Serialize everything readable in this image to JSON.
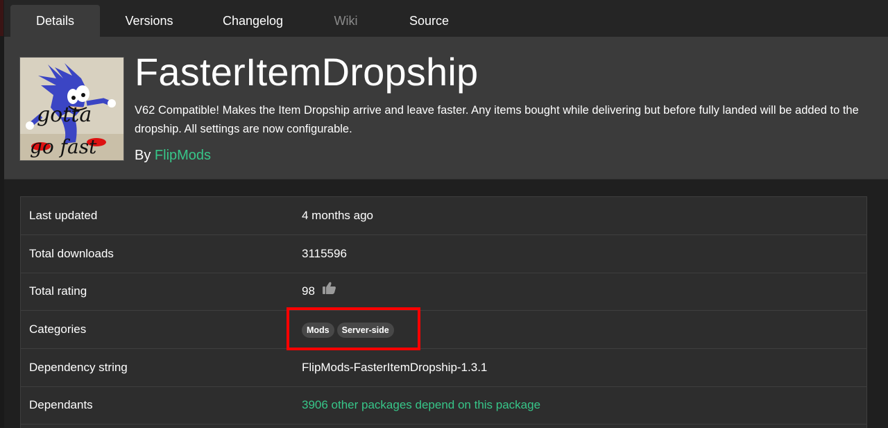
{
  "tabs": [
    {
      "label": "Details"
    },
    {
      "label": "Versions"
    },
    {
      "label": "Changelog"
    },
    {
      "label": "Wiki"
    },
    {
      "label": "Source"
    }
  ],
  "package": {
    "title": "FasterItemDropship",
    "description": "V62 Compatible! Makes the Item Dropship arrive and leave faster. Any items bought while delivering but before fully landed will be added to the dropship. All settings are now configurable.",
    "by_label": "By",
    "author": "FlipMods",
    "thumbnail_text_line1": "gotta",
    "thumbnail_text_line2": "go fast"
  },
  "details": {
    "last_updated": {
      "label": "Last updated",
      "value": "4 months ago"
    },
    "total_downloads": {
      "label": "Total downloads",
      "value": "3115596"
    },
    "total_rating": {
      "label": "Total rating",
      "value": "98"
    },
    "categories": {
      "label": "Categories",
      "items": [
        "Mods",
        "Server-side"
      ]
    },
    "dependency_string": {
      "label": "Dependency string",
      "value": "FlipMods-FasterItemDropship-1.3.1"
    },
    "dependants": {
      "label": "Dependants",
      "value": "3906 other packages depend on this package"
    }
  },
  "colors": {
    "accent": "#37c689",
    "highlight": "#ff0000"
  },
  "icons": {
    "rating": "thumbs-up-icon"
  }
}
